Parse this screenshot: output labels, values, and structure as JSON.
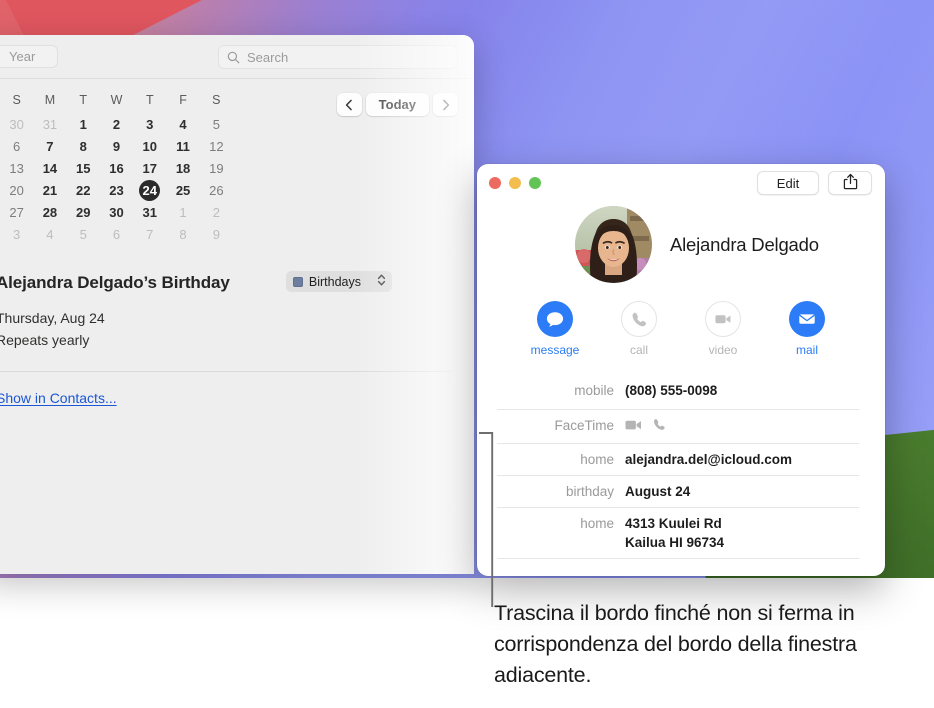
{
  "calendar_window": {
    "toolbar": {
      "year_button_label": "Year",
      "search_placeholder": "Search",
      "search_value": "",
      "search_icon": "search-icon"
    },
    "navigation": {
      "prev_icon": "chevron-left-icon",
      "today_label": "Today",
      "next_icon": "chevron-right-icon"
    },
    "month_grid": {
      "weekday_headers": [
        "S",
        "M",
        "T",
        "W",
        "T",
        "F",
        "S"
      ],
      "today": 24,
      "weeks": [
        [
          {
            "day": 30,
            "type": "adjacent"
          },
          {
            "day": 31,
            "type": "adjacent"
          },
          {
            "day": 1,
            "type": "weekday"
          },
          {
            "day": 2,
            "type": "weekday"
          },
          {
            "day": 3,
            "type": "weekday"
          },
          {
            "day": 4,
            "type": "weekday"
          },
          {
            "day": 5,
            "type": "weekend"
          }
        ],
        [
          {
            "day": 6,
            "type": "weekend"
          },
          {
            "day": 7,
            "type": "weekday"
          },
          {
            "day": 8,
            "type": "weekday"
          },
          {
            "day": 9,
            "type": "weekday"
          },
          {
            "day": 10,
            "type": "weekday"
          },
          {
            "day": 11,
            "type": "weekday"
          },
          {
            "day": 12,
            "type": "weekend"
          }
        ],
        [
          {
            "day": 13,
            "type": "weekend"
          },
          {
            "day": 14,
            "type": "weekday"
          },
          {
            "day": 15,
            "type": "weekday"
          },
          {
            "day": 16,
            "type": "weekday"
          },
          {
            "day": 17,
            "type": "weekday"
          },
          {
            "day": 18,
            "type": "weekday"
          },
          {
            "day": 19,
            "type": "weekend"
          }
        ],
        [
          {
            "day": 20,
            "type": "weekend"
          },
          {
            "day": 21,
            "type": "weekday"
          },
          {
            "day": 22,
            "type": "weekday"
          },
          {
            "day": 23,
            "type": "weekday"
          },
          {
            "day": 24,
            "type": "today"
          },
          {
            "day": 25,
            "type": "weekday"
          },
          {
            "day": 26,
            "type": "weekend"
          }
        ],
        [
          {
            "day": 27,
            "type": "weekend"
          },
          {
            "day": 28,
            "type": "weekday"
          },
          {
            "day": 29,
            "type": "weekday"
          },
          {
            "day": 30,
            "type": "weekday"
          },
          {
            "day": 31,
            "type": "weekday"
          },
          {
            "day": 1,
            "type": "adjacent"
          },
          {
            "day": 2,
            "type": "adjacent"
          }
        ],
        [
          {
            "day": 3,
            "type": "adjacent"
          },
          {
            "day": 4,
            "type": "adjacent"
          },
          {
            "day": 5,
            "type": "adjacent"
          },
          {
            "day": 6,
            "type": "adjacent"
          },
          {
            "day": 7,
            "type": "adjacent"
          },
          {
            "day": 8,
            "type": "adjacent"
          },
          {
            "day": 9,
            "type": "adjacent"
          }
        ]
      ]
    },
    "event": {
      "title": "Alejandra Delgado’s Birthday",
      "calendar_chip_label": "Birthdays",
      "calendar_chip_color": "#6d7e9e",
      "date_line": "Thursday, Aug 24",
      "repeat_line": "Repeats yearly",
      "show_in_contacts_label": "Show in Contacts..."
    }
  },
  "contact_window": {
    "titlebar": {
      "close_label": "close",
      "minimize_label": "minimize",
      "zoom_label": "zoom",
      "edit_label": "Edit",
      "share_icon": "share-icon"
    },
    "contact_name": "Alejandra Delgado",
    "avatar_name": "contact-avatar",
    "actions": [
      {
        "label": "message",
        "icon": "message-bubble-icon",
        "state": "on"
      },
      {
        "label": "call",
        "icon": "phone-icon",
        "state": "off"
      },
      {
        "label": "video",
        "icon": "video-camera-icon",
        "state": "off"
      },
      {
        "label": "mail",
        "icon": "envelope-icon",
        "state": "on"
      }
    ],
    "details": [
      {
        "label": "mobile",
        "value": "(808) 555-0098",
        "kind": "text"
      },
      {
        "label": "FaceTime",
        "value": "",
        "kind": "icons",
        "icons": [
          "video-camera-icon",
          "phone-icon"
        ]
      },
      {
        "label": "home",
        "value": "alejandra.del@icloud.com",
        "kind": "text"
      },
      {
        "label": "birthday",
        "value": "August 24",
        "kind": "text"
      },
      {
        "label": "home",
        "value": "4313 Kuulei Rd\nKailua HI 96734",
        "kind": "multiline"
      }
    ]
  },
  "annotation": {
    "caption": "Trascina il bordo finché non si ferma in corrispondenza del bordo della finestra adiacente.",
    "callout_name": "window-edge-callout-line"
  },
  "colors": {
    "accent_blue": "#2b7cf6",
    "link_blue": "#1a56d6",
    "today_marker": "#2b2b2b",
    "calendar_swatch": "#6d7e9e"
  }
}
